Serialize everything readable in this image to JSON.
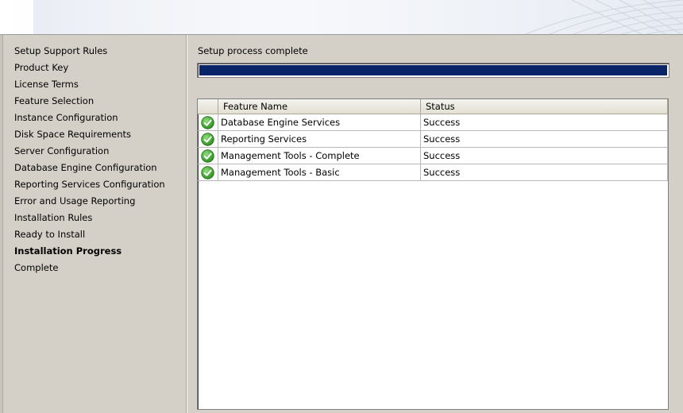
{
  "sidebar": {
    "items": [
      {
        "label": "Setup Support Rules",
        "active": false
      },
      {
        "label": "Product Key",
        "active": false
      },
      {
        "label": "License Terms",
        "active": false
      },
      {
        "label": "Feature Selection",
        "active": false
      },
      {
        "label": "Instance Configuration",
        "active": false
      },
      {
        "label": "Disk Space Requirements",
        "active": false
      },
      {
        "label": "Server Configuration",
        "active": false
      },
      {
        "label": "Database Engine Configuration",
        "active": false
      },
      {
        "label": "Reporting Services Configuration",
        "active": false
      },
      {
        "label": "Error and Usage Reporting",
        "active": false
      },
      {
        "label": "Installation Rules",
        "active": false
      },
      {
        "label": "Ready to Install",
        "active": false
      },
      {
        "label": "Installation Progress",
        "active": true
      },
      {
        "label": "Complete",
        "active": false
      }
    ]
  },
  "main": {
    "status_text": "Setup process complete",
    "progress_percent": 100,
    "table": {
      "columns": [
        "",
        "Feature Name",
        "Status"
      ],
      "rows": [
        {
          "icon": "success-check-icon",
          "feature": "Database Engine Services",
          "status": "Success"
        },
        {
          "icon": "success-check-icon",
          "feature": "Reporting Services",
          "status": "Success"
        },
        {
          "icon": "success-check-icon",
          "feature": "Management Tools - Complete",
          "status": "Success"
        },
        {
          "icon": "success-check-icon",
          "feature": "Management Tools - Basic",
          "status": "Success"
        }
      ]
    }
  },
  "colors": {
    "progress_fill": "#0a246a",
    "success_green": "#3a9a2e",
    "window_bg": "#d4d0c8"
  }
}
